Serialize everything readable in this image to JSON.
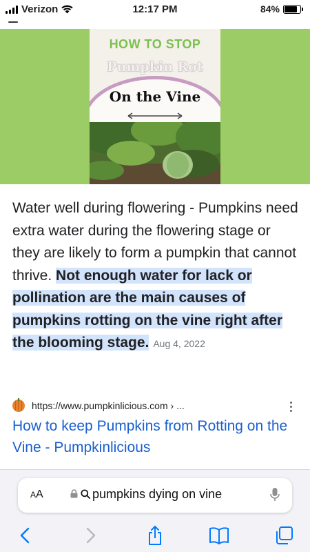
{
  "status_bar": {
    "carrier": "Verizon",
    "time": "12:17 PM",
    "battery_percent": "84%",
    "battery_level": 0.84,
    "icons": [
      "signal-icon",
      "wifi-icon",
      "battery-icon"
    ]
  },
  "hero_image": {
    "line1": "HOW TO STOP",
    "line2": "Pumpkin Rot",
    "line3": "On the Vine",
    "colors": {
      "background": "#9ccc65",
      "accent_green": "#7cc04f",
      "circle": "#c79bc2"
    }
  },
  "snippet": {
    "text_plain": "Water well during flowering - Pumpkins need extra water during the flowering stage or they are likely to form a pumpkin that cannot thrive. ",
    "text_highlight": "Not enough water for lack or pollination are the main causes of pumpkins rotting on the vine right after the blooming stage.",
    "date": "Aug 4, 2022",
    "highlight_color": "#d2e3fc"
  },
  "result": {
    "source_url": "https://www.pumpkinlicious.com › ...",
    "title": "How to keep Pumpkins from Rotting on the Vine - Pumpkinlicious",
    "link_color": "#1a5fd0",
    "favicon": "pumpkin-favicon-icon",
    "menu_icon": "more-vert-icon"
  },
  "browser": {
    "aa_label": "AA",
    "address_text": "pumpkins dying on vine",
    "icons": [
      "lock-icon",
      "search-icon",
      "mic-icon"
    ],
    "toolbar": [
      "back-icon",
      "forward-icon",
      "share-icon",
      "bookmarks-icon",
      "tabs-icon"
    ],
    "accent": "#007aff"
  }
}
